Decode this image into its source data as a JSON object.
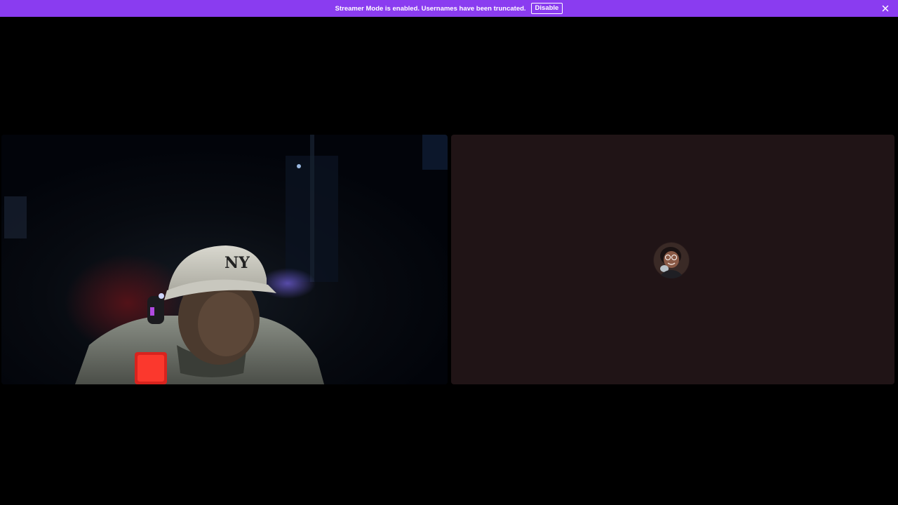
{
  "notice": {
    "text": "Streamer Mode is enabled. Usernames have been truncated.",
    "disable_label": "Disable",
    "close_icon": "close-icon",
    "background": "#8a3cf0"
  },
  "participants": [
    {
      "type": "video",
      "description_icon": "webcam-video-feed"
    },
    {
      "type": "audio",
      "avatar_icon": "user-avatar",
      "background": "#201416"
    }
  ]
}
